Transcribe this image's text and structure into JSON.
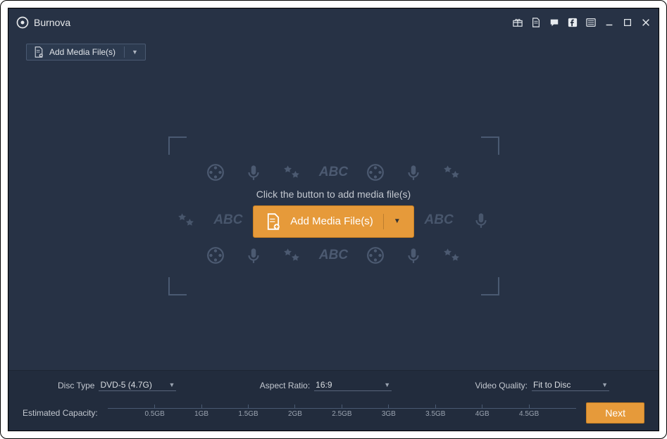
{
  "app_name": "Burnova",
  "toolbar": {
    "add_media_label": "Add Media File(s)"
  },
  "main": {
    "hint": "Click the button to add media file(s)",
    "add_button_label": "Add Media File(s)",
    "bg_text": "ABC"
  },
  "settings": {
    "disc_type_label": "Disc Type",
    "disc_type_value": "DVD-5 (4.7G)",
    "aspect_ratio_label": "Aspect Ratio:",
    "aspect_ratio_value": "16:9",
    "video_quality_label": "Video Quality:",
    "video_quality_value": "Fit to Disc"
  },
  "capacity": {
    "label": "Estimated Capacity:",
    "ticks": [
      "0.5GB",
      "1GB",
      "1.5GB",
      "2GB",
      "2.5GB",
      "3GB",
      "3.5GB",
      "4GB",
      "4.5GB"
    ]
  },
  "next_label": "Next"
}
